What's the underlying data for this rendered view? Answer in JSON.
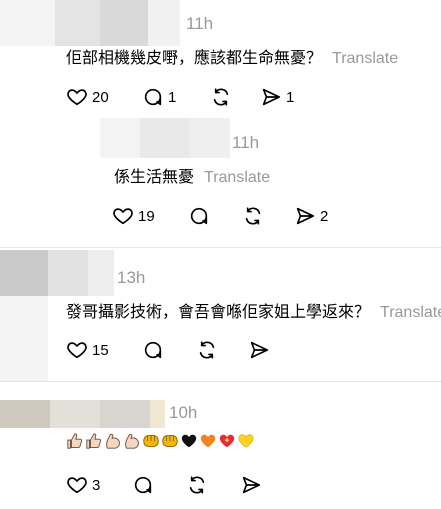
{
  "comments": [
    {
      "timestamp": "11h",
      "text": "佢部相機幾皮嘢，應該都生命無憂？",
      "translate": "Translate",
      "likes": "20",
      "replies": "1",
      "reposts": "",
      "shares": "1"
    },
    {
      "timestamp": "11h",
      "text": "係生活無憂",
      "translate": "Translate",
      "likes": "19",
      "replies": "",
      "reposts": "",
      "shares": "2"
    },
    {
      "timestamp": "13h",
      "text": "發哥攝影技術，會吾會喺佢家姐上學返來？",
      "translate": "Translate",
      "likes": "15",
      "replies": "",
      "reposts": "",
      "shares": ""
    },
    {
      "timestamp": "10h",
      "emojis": [
        "thumbs-up-light",
        "thumbs-up-light",
        "flexed-biceps-light",
        "flexed-biceps-light",
        "oncoming-fist-yellow",
        "oncoming-fist-yellow",
        "black-heart",
        "orange-heart",
        "sparkling-heart",
        "yellow-heart"
      ],
      "likes": "3",
      "replies": "",
      "reposts": "",
      "shares": ""
    }
  ]
}
